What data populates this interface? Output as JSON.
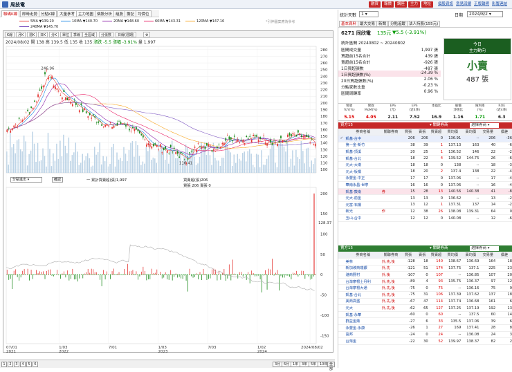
{
  "topbar": {
    "stock": "周技電",
    "buttons": [
      "融資",
      "報價",
      "講座",
      "主力",
      "地址"
    ],
    "links": [
      "個股資訊",
      "意見回饋",
      "正版聲明",
      "影響連結"
    ]
  },
  "tabs": [
    "聯碼K線",
    "即時走勢",
    "分點K線",
    "大量參考",
    "主力地圖",
    "個股分析",
    "組股",
    "籌記",
    "均價位"
  ],
  "ma": [
    {
      "label": "5MA ▼139.20",
      "color": "#e53935"
    },
    {
      "label": "10MA ▼140.70",
      "color": "#1e88e5"
    },
    {
      "label": "20MA ▼148.60",
      "color": "#8e24aa"
    },
    {
      "label": "60MA ▼143.31",
      "color": "#e91e63"
    },
    {
      "label": "120MA ▼147.16",
      "color": "#f9a825"
    },
    {
      "label": "240MA ▼145.70",
      "color": "#7e57c2"
    }
  ],
  "ma_note": "*引伸圖案應為參考",
  "chart_tools": [
    "K線",
    "月K",
    "週K",
    "日K",
    "分K",
    "單位",
    "季線",
    "全區域",
    "分張數",
    "日線(週期)",
    "設定"
  ],
  "chart_info": {
    "line1": "2024/08/02 開 138 高 139.5 低 135 收 135",
    "change": "漲跌 -5.5 漲幅 -3.91%",
    "vol": "量 1,997"
  },
  "peak_label": "246.96",
  "low_label": "116.41",
  "right_last": "128.37",
  "y_main": [
    "280",
    "270",
    "260",
    "250",
    "240",
    "230",
    "220",
    "210",
    "200",
    "190",
    "180",
    "170",
    "160",
    "150",
    "140",
    "130",
    "120",
    "110",
    "100"
  ],
  "y_sub": [
    "200",
    "150",
    "100",
    "50",
    "0",
    "-50",
    "-100",
    "-150"
  ],
  "sub_header": {
    "select": "分點進出",
    "btn": "確認",
    "legend1": "一 累計買賣超(張)1,997",
    "legend2": "買賣超(張)206",
    "legend3": "買張 206 賣張 0"
  },
  "x_labels": [
    "07/01\n2021",
    "1/03\n2022",
    "7/01",
    "1/03\n2023",
    "7/03",
    "1/02\n2024",
    "2024/08/02"
  ],
  "bottom": {
    "pages": [
      "1",
      "2",
      "3",
      "4",
      "5",
      "6"
    ],
    "periods": [
      "3月",
      "6月",
      "1年",
      "3年",
      "5年",
      "10年",
      "全部"
    ]
  },
  "right": {
    "stat_label": "統計天數",
    "stat_value": "1",
    "date_label": "日期",
    "date_value": "2024/8/2",
    "rtabs": [
      "基本資料",
      "最大交易",
      "新聞",
      "分點追蹤",
      "法人持股(155元)"
    ],
    "stock_name": "6271 同欣電",
    "price": "135元",
    "chg": "▼5.5 (-3.91%)",
    "kv": [
      {
        "k": "統計區間  20240802 ~ 20240802",
        "v": ""
      },
      {
        "k": "區間成交量",
        "v": "1,997 張"
      },
      {
        "k": "買超前15名合計",
        "v": "439 張"
      },
      {
        "k": "賣超前15名合計",
        "v": "-926 張"
      },
      {
        "k": "1日買超張數",
        "v": "-487 張"
      },
      {
        "k": "1日買超張數(%)",
        "v": "-24.39 %"
      },
      {
        "k": "20日買超張數(%)",
        "v": "2.06 %"
      },
      {
        "k": "分點家數比重",
        "v": "-0.23 %"
      },
      {
        "k": "區間周轉率",
        "v": "0.96 %"
      }
    ],
    "today_title": "今日",
    "today_sub": "主力動向",
    "today_big": "小賣",
    "today_num": "487 張",
    "fund_hdr": [
      "營收\nYoY(%)",
      "營收\nMoM(%)",
      "EPS\n(元)",
      "EPS\n(近4季)",
      "本益比",
      "股價\n淨值比",
      "殖利率\n(%)",
      "ROE\n(近4季)"
    ],
    "fund_val": [
      "5.15",
      "4.05",
      "2.11",
      "7.52",
      "16.9",
      "1.16",
      "1.71",
      "6.3"
    ],
    "buy_title": "買方15",
    "sell_title": "賣方15",
    "buy_select": "選擇",
    "table_hdr": [
      "",
      "券商名稱",
      "關聯券商",
      "買張",
      "賣張",
      "買賣超",
      "買均價",
      "賣均價",
      "交易量",
      "價差"
    ],
    "buy_rows": [
      [
        "✓",
        "凱基-台中",
        "",
        "206",
        "206",
        "0",
        "136.91",
        "--",
        "206",
        "-36"
      ],
      [
        "",
        "第一金-新竹",
        "",
        "38",
        "39",
        "1",
        "137.13",
        "163",
        "40",
        "-6"
      ],
      [
        "",
        "凱基-頂溪",
        "",
        "20",
        "25",
        "1",
        "136.52",
        "146",
        "22",
        "-2"
      ],
      [
        "",
        "凱基-台北",
        "",
        "18",
        "22",
        "4",
        "139.52",
        "144.75",
        "26",
        "-6"
      ],
      [
        "",
        "元大-大墩",
        "",
        "18",
        "18",
        "0",
        "138",
        "--",
        "18",
        "-3"
      ],
      [
        "",
        "元大-板橋",
        "",
        "18",
        "20",
        "2",
        "137.4",
        "138",
        "22",
        "-4"
      ],
      [
        "",
        "永豐金-中正",
        "",
        "17",
        "17",
        "0",
        "137.06",
        "--",
        "17",
        "-4"
      ],
      [
        "",
        "華南永昌-世寧",
        "",
        "16",
        "16",
        "0",
        "137.06",
        "--",
        "16",
        "-4"
      ],
      [
        "",
        "凱基-鼓南",
        "券",
        "15",
        "28",
        "13",
        "140.56",
        "140.38",
        "41",
        "-8"
      ],
      [
        "",
        "元大-前金",
        "",
        "13",
        "13",
        "0",
        "136.62",
        "--",
        "13",
        "-2"
      ],
      [
        "",
        "元富-石橋",
        "",
        "13",
        "12",
        "1",
        "137.31",
        "137",
        "14",
        "-2"
      ],
      [
        "",
        "新光",
        "作",
        "12",
        "38",
        "26",
        "138.08",
        "139.31",
        "64",
        "0"
      ],
      [
        "",
        "玉山-台中",
        "",
        "12",
        "12",
        "0",
        "140.08",
        "--",
        "12",
        "-6"
      ]
    ],
    "sell_rows": [
      [
        "",
        "美林",
        "外,先,後",
        "-128",
        "18",
        "140",
        "138.67",
        "136.69",
        "164",
        "18"
      ],
      [
        "",
        "新加坡商瑞銀",
        "外,先",
        "-121",
        "51",
        "174",
        "137.75",
        "137.1",
        "225",
        "23"
      ],
      [
        "",
        "港商野村",
        "外,後",
        "-107",
        "0",
        "107",
        "--",
        "136.85",
        "107",
        "20"
      ],
      [
        "",
        "台灣摩根士丹利",
        "外,先,後",
        "-89",
        "4",
        "93",
        "135.75",
        "136.37",
        "97",
        "12"
      ],
      [
        "",
        "台灣摩根大通",
        "外,先,後",
        "-75",
        "0",
        "75",
        "--",
        "136.16",
        "75",
        "9"
      ],
      [
        "",
        "凱基-台北",
        "外,先,後",
        "-75",
        "31",
        "106",
        "137.39",
        "137.62",
        "137",
        "18"
      ],
      [
        "",
        "美商高盛",
        "外,先,後",
        "-67",
        "47",
        "114",
        "137.74",
        "136.68",
        "161",
        "6"
      ],
      [
        "",
        "元大",
        "外,先,後",
        "-62",
        "65",
        "127",
        "137.25",
        "137.19",
        "192",
        "13"
      ],
      [
        "",
        "凱基-永華",
        "",
        "-60",
        "0",
        "60",
        "--",
        "137.5",
        "60",
        "14"
      ],
      [
        "",
        "群益金鼎",
        "",
        "-27",
        "6",
        "33",
        "135.5",
        "137.06",
        "39",
        "6"
      ],
      [
        "",
        "永豐金-永康",
        "",
        "-26",
        "1",
        "27",
        "169",
        "137.41",
        "28",
        "8"
      ],
      [
        "",
        "富邦",
        "",
        "-24",
        "0",
        "24",
        "--",
        "136.08",
        "24",
        "3"
      ],
      [
        "",
        "台灣金",
        "",
        "-22",
        "30",
        "52",
        "139.97",
        "138.37",
        "82",
        "2"
      ]
    ]
  }
}
